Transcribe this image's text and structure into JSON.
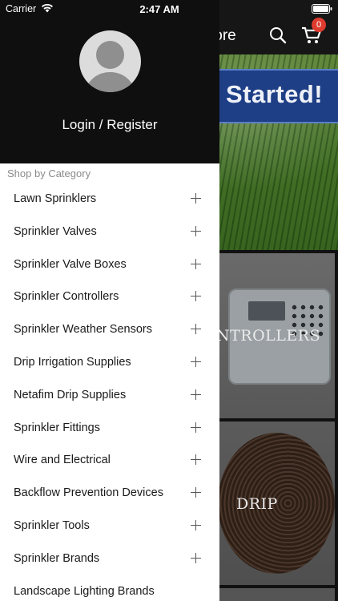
{
  "status_bar": {
    "carrier": "Carrier",
    "time": "2:47 AM"
  },
  "background": {
    "title_fragment": "tore",
    "cart_count": "0",
    "hero_text": "Started!",
    "tiles": [
      {
        "label": "NTROLLERS"
      },
      {
        "label": "DRIP"
      }
    ]
  },
  "drawer": {
    "login_label": "Login / Register",
    "section_title": "Shop by Category",
    "categories": [
      {
        "label": "Lawn Sprinklers"
      },
      {
        "label": "Sprinkler Valves"
      },
      {
        "label": "Sprinkler Valve Boxes"
      },
      {
        "label": "Sprinkler Controllers"
      },
      {
        "label": "Sprinkler Weather Sensors"
      },
      {
        "label": "Drip Irrigation Supplies"
      },
      {
        "label": "Netafim Drip Supplies"
      },
      {
        "label": "Sprinkler Fittings"
      },
      {
        "label": "Wire and Electrical"
      },
      {
        "label": "Backflow Prevention Devices"
      },
      {
        "label": "Sprinkler Tools"
      },
      {
        "label": "Sprinkler Brands"
      },
      {
        "label": "Landscape Lighting Brands"
      }
    ]
  },
  "colors": {
    "drawer_header": "#0f0f0f",
    "banner": "#1e3f86",
    "badge": "#e03b2f"
  }
}
